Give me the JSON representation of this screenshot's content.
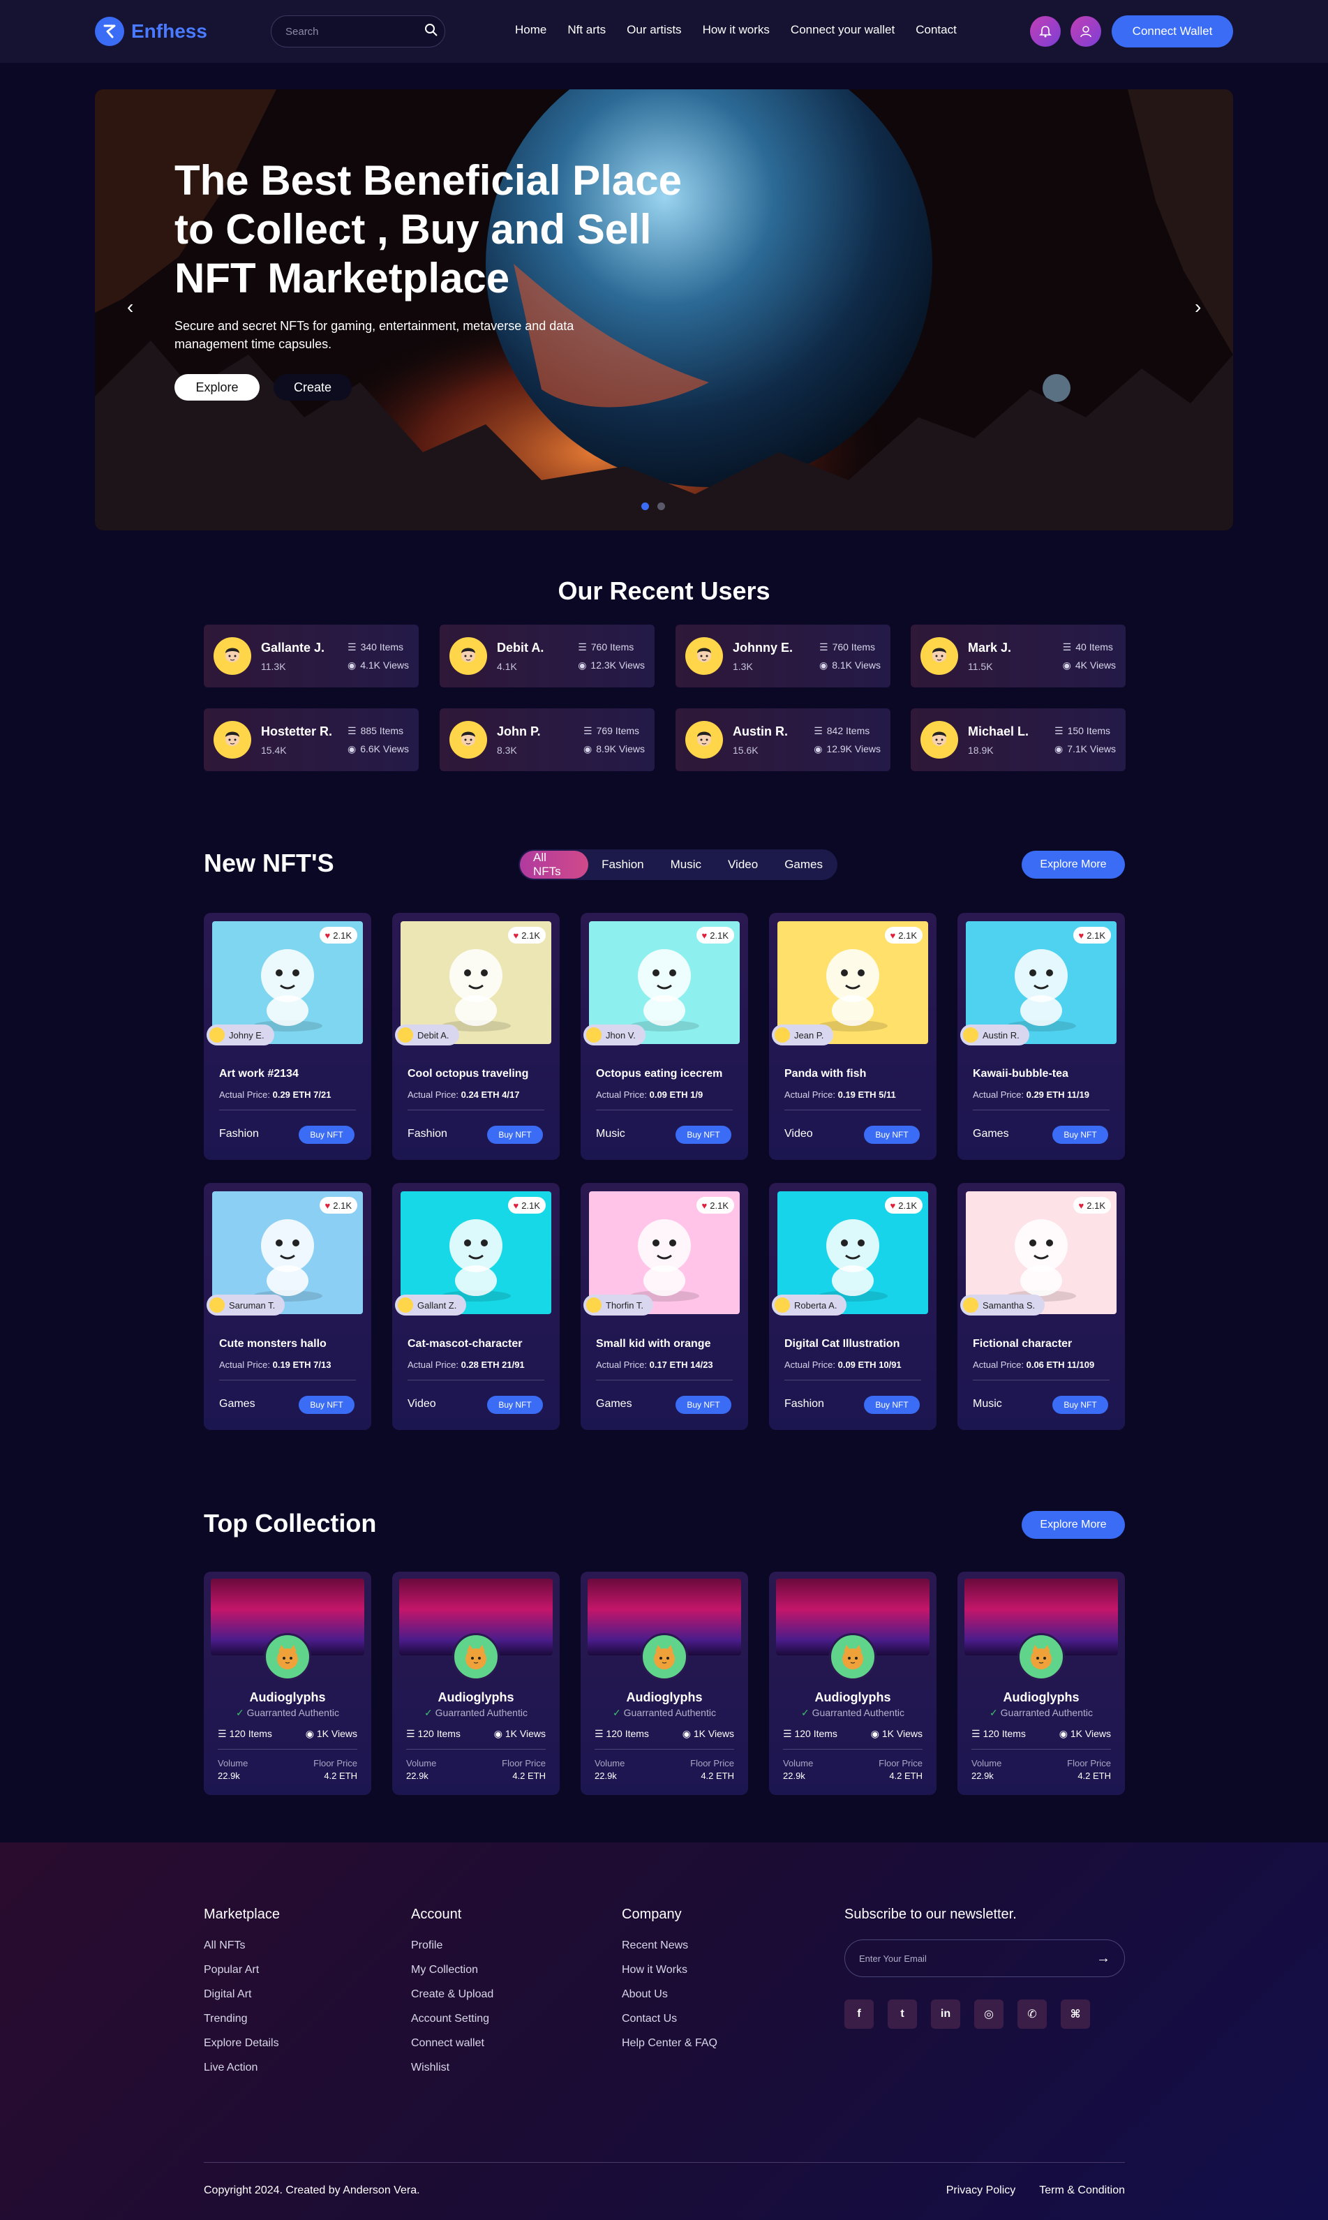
{
  "brand": {
    "name": "Enfhess",
    "accent": "#3b6cf5"
  },
  "search": {
    "placeholder": "Search"
  },
  "nav": [
    "Home",
    "Nft arts",
    "Our artists",
    "How it works",
    "Connect your wallet",
    "Contact"
  ],
  "header": {
    "connect_label": "Connect Wallet"
  },
  "hero": {
    "title": "The Best Beneficial Place to Collect , Buy and Sell NFT Marketplace",
    "subtitle": "Secure and secret NFTs for gaming, entertainment, metaverse and data management time capsules.",
    "explore_label": "Explore",
    "create_label": "Create",
    "prev": "‹",
    "next": "›"
  },
  "recent_users": {
    "title": "Our Recent Users",
    "users": [
      {
        "name": "Gallante J.",
        "score": "11.3K",
        "items": "340 Items",
        "views": "4.1K Views"
      },
      {
        "name": "Debit A.",
        "score": "4.1K",
        "items": "760 Items",
        "views": "12.3K Views"
      },
      {
        "name": "Johnny E.",
        "score": "1.3K",
        "items": "760 Items",
        "views": "8.1K Views"
      },
      {
        "name": "Mark J.",
        "score": "11.5K",
        "items": "40 Items",
        "views": "4K Views"
      },
      {
        "name": "Hostetter R.",
        "score": "15.4K",
        "items": "885 Items",
        "views": "6.6K Views"
      },
      {
        "name": "John P.",
        "score": "8.3K",
        "items": "769 Items",
        "views": "8.9K Views"
      },
      {
        "name": "Austin R.",
        "score": "15.6K",
        "items": "842 Items",
        "views": "12.9K Views"
      },
      {
        "name": "Michael L.",
        "score": "18.9K",
        "items": "150 Items",
        "views": "7.1K Views"
      }
    ]
  },
  "new_nfts": {
    "title": "New NFT'S",
    "filters": [
      "All NFTs",
      "Fashion",
      "Music",
      "Video",
      "Games"
    ],
    "explore_label": "Explore More",
    "price_label": "Actual Price:",
    "buy_label": "Buy NFT",
    "items": [
      {
        "title": "Art work #2134",
        "owner": "Johny E.",
        "likes": "2.1K",
        "price": "0.29 ETH 7/21",
        "category": "Fashion",
        "bg": "#7fd6f0"
      },
      {
        "title": "Cool octopus traveling",
        "owner": "Debit A.",
        "likes": "2.1K",
        "price": "0.24 ETH 4/17",
        "category": "Fashion",
        "bg": "#ece6b4"
      },
      {
        "title": "Octopus eating icecrem",
        "owner": "Jhon V.",
        "likes": "2.1K",
        "price": "0.09 ETH 1/9",
        "category": "Music",
        "bg": "#8ef0ee"
      },
      {
        "title": "Panda with fish",
        "owner": "Jean P.",
        "likes": "2.1K",
        "price": "0.19 ETH 5/11",
        "category": "Video",
        "bg": "#ffe06a"
      },
      {
        "title": "Kawaii-bubble-tea",
        "owner": "Austin R.",
        "likes": "2.1K",
        "price": "0.29 ETH 11/19",
        "category": "Games",
        "bg": "#4fd2f0"
      },
      {
        "title": "Cute monsters hallo",
        "owner": "Saruman T.",
        "likes": "2.1K",
        "price": "0.19 ETH 7/13",
        "category": "Games",
        "bg": "#8ccff4"
      },
      {
        "title": "Cat-mascot-character",
        "owner": "Gallant Z.",
        "likes": "2.1K",
        "price": "0.28 ETH 21/91",
        "category": "Video",
        "bg": "#16d8e6"
      },
      {
        "title": "Small kid with orange",
        "owner": "Thorfin T.",
        "likes": "2.1K",
        "price": "0.17 ETH 14/23",
        "category": "Games",
        "bg": "#ffc4e8"
      },
      {
        "title": "Digital Cat Illustration",
        "owner": "Roberta A.",
        "likes": "2.1K",
        "price": "0.09 ETH 10/91",
        "category": "Fashion",
        "bg": "#17d4ea"
      },
      {
        "title": "Fictional character",
        "owner": "Samantha S.",
        "likes": "2.1K",
        "price": "0.06 ETH 11/109",
        "category": "Music",
        "bg": "#fde2e8"
      }
    ]
  },
  "top_collection": {
    "title": "Top Collection",
    "explore_label": "Explore More",
    "items": [
      {
        "name": "Audioglyphs",
        "verified": "Guarranted Authentic",
        "items": "120 Items",
        "views": "1K Views",
        "volume_label": "Volume",
        "volume": "22.9k",
        "floor_label": "Floor Price",
        "floor": "4.2 ETH"
      },
      {
        "name": "Audioglyphs",
        "verified": "Guarranted Authentic",
        "items": "120 Items",
        "views": "1K Views",
        "volume_label": "Volume",
        "volume": "22.9k",
        "floor_label": "Floor Price",
        "floor": "4.2 ETH"
      },
      {
        "name": "Audioglyphs",
        "verified": "Guarranted Authentic",
        "items": "120 Items",
        "views": "1K Views",
        "volume_label": "Volume",
        "volume": "22.9k",
        "floor_label": "Floor Price",
        "floor": "4.2 ETH"
      },
      {
        "name": "Audioglyphs",
        "verified": "Guarranted Authentic",
        "items": "120 Items",
        "views": "1K Views",
        "volume_label": "Volume",
        "volume": "22.9k",
        "floor_label": "Floor Price",
        "floor": "4.2 ETH"
      },
      {
        "name": "Audioglyphs",
        "verified": "Guarranted Authentic",
        "items": "120 Items",
        "views": "1K Views",
        "volume_label": "Volume",
        "volume": "22.9k",
        "floor_label": "Floor Price",
        "floor": "4.2 ETH"
      }
    ]
  },
  "footer": {
    "marketplace": {
      "title": "Marketplace",
      "links": [
        "All NFTs",
        "Popular Art",
        "Digital Art",
        "Trending",
        "Explore Details",
        "Live Action"
      ]
    },
    "account": {
      "title": "Account",
      "links": [
        "Profile",
        "My Collection",
        "Create & Upload",
        "Account Setting",
        "Connect wallet",
        "Wishlist"
      ]
    },
    "company": {
      "title": "Company",
      "links": [
        "Recent News",
        "How it Works",
        "About Us",
        "Contact Us",
        "Help Center & FAQ"
      ]
    },
    "newsletter": {
      "title": "Subscribe to our newsletter.",
      "placeholder": "Enter Your Email",
      "submit": "→"
    },
    "socials": [
      "f",
      "t",
      "in",
      "◎",
      "✆",
      "⌘"
    ],
    "copyright": "Copyright 2024. Created by Anderson Vera.",
    "privacy": "Privacy Policy",
    "terms": "Term & Condition"
  }
}
